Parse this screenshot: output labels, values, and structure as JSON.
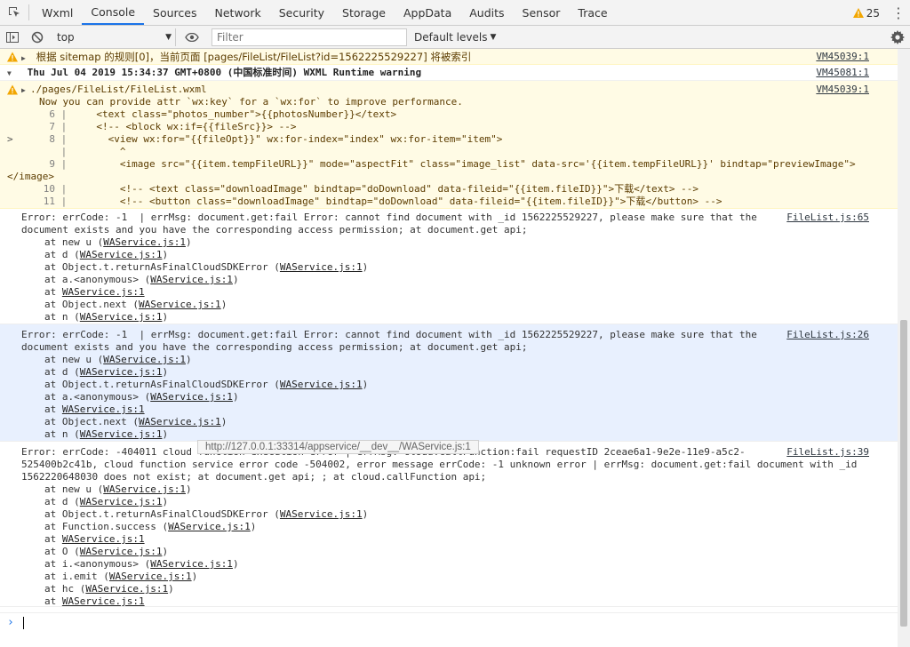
{
  "tabs": [
    "Wxml",
    "Console",
    "Sources",
    "Network",
    "Security",
    "Storage",
    "AppData",
    "Audits",
    "Sensor",
    "Trace"
  ],
  "active_tab": "Console",
  "warning_count": "25",
  "toolbar": {
    "context": "top",
    "filter_placeholder": "Filter",
    "levels": "Default levels"
  },
  "messages": {
    "w1": {
      "text": "根据 sitemap 的规则[0]，当前页面 [pages/FileList/FileList?id=1562225529227] 将被索引",
      "source": "VM45039:1"
    },
    "group": {
      "text": "Thu Jul 04 2019 15:34:37 GMT+0800 (中国标准时间) WXML Runtime warning",
      "source": "VM45081:1"
    },
    "w2": {
      "path": "./pages/FileList/FileList.wxml",
      "source": "VM45039:1",
      "hint": "Now you can provide attr `wx:key` for a `wx:for` to improve performance.",
      "code": [
        {
          "ln": "6",
          "gut": "",
          "text": "     <text class=\"photos_number\">{{photosNumber}}</text>"
        },
        {
          "ln": "7",
          "gut": "",
          "text": "     <!-- <block wx:if={{fileSrc}}> -->"
        },
        {
          "ln": "8",
          "gut": ">",
          "text": "       <view wx:for=\"{{fileOpt}}\" wx:for-index=\"index\" wx:for-item=\"item\">"
        },
        {
          "ln": "",
          "gut": "",
          "text": "         ^"
        },
        {
          "ln": "9",
          "gut": "",
          "text": "         <image src=\"{{item.tempFileURL}}\" mode=\"aspectFit\" class=\"image_list\" data-src='{{item.tempFileURL}}' bindtap=\"previewImage\">"
        },
        {
          "ln": "",
          "gut": "",
          "text": "</image>"
        },
        {
          "ln": "10",
          "gut": "",
          "text": "         <!-- <text class=\"downloadImage\" bindtap=\"doDownload\" data-fileid=\"{{item.fileID}}\">下载</text> -->"
        },
        {
          "ln": "11",
          "gut": "",
          "text": "         <!-- <button class=\"downloadImage\" bindtap=\"doDownload\" data-fileid=\"{{item.fileID}}\">下载</button> -->"
        }
      ]
    },
    "e1": {
      "line1": "Error: errCode: -1  | errMsg: document.get:fail Error: cannot find document with _id 1562225529227, please make sure that the",
      "line2": "document exists and you have the corresponding access permission; at document.get api;",
      "source": "FileList.js:65"
    },
    "e2": {
      "line1": "Error: errCode: -1  | errMsg: document.get:fail Error: cannot find document with _id 1562225529227, please make sure that the",
      "line2": "document exists and you have the corresponding access permission; at document.get api;",
      "source": "FileList.js:26"
    },
    "e3": {
      "line1": "Error: errCode: -404011 cloud function execution error | errMsg: cloud.callFunction:fail requestID 2ceae6a1-9e2e-11e9-a5c2-",
      "line2": "525400b2c41b, cloud function service error code -504002, error message errCode: -1 unknown error | errMsg: document.get:fail document with _id",
      "line3": "1562220648030 does not exist; at document.get api; ; at cloud.callFunction api;",
      "source": "FileList.js:39"
    }
  },
  "stacks": {
    "e1": [
      {
        "pre": "at new u (",
        "link": "WAService.js:1",
        "post": ")"
      },
      {
        "pre": "at d (",
        "link": "WAService.js:1",
        "post": ")"
      },
      {
        "pre": "at Object.t.returnAsFinalCloudSDKError (",
        "link": "WAService.js:1",
        "post": ")"
      },
      {
        "pre": "at a.<anonymous> (",
        "link": "WAService.js:1",
        "post": ")"
      },
      {
        "pre": "at ",
        "link": "WAService.js:1",
        "post": ""
      },
      {
        "pre": "at Object.next (",
        "link": "WAService.js:1",
        "post": ")"
      },
      {
        "pre": "at n (",
        "link": "WAService.js:1",
        "post": ")"
      }
    ],
    "e2": [
      {
        "pre": "at new u (",
        "link": "WAService.js:1",
        "post": ")"
      },
      {
        "pre": "at d (",
        "link": "WAService.js:1",
        "post": ")"
      },
      {
        "pre": "at Object.t.returnAsFinalCloudSDKError (",
        "link": "WAService.js:1",
        "post": ")"
      },
      {
        "pre": "at a.<anonymous> (",
        "link": "WAService.js:1",
        "post": ")"
      },
      {
        "pre": "at ",
        "link": "WAService.js:1",
        "post": ""
      },
      {
        "pre": "at Object.next (",
        "link": "WAService.js:1",
        "post": ")"
      },
      {
        "pre": "at n (",
        "link": "WAService.js:1",
        "post": ")"
      }
    ],
    "e3": [
      {
        "pre": "at new u (",
        "link": "WAService.js:1",
        "post": ")"
      },
      {
        "pre": "at d (",
        "link": "WAService.js:1",
        "post": ")"
      },
      {
        "pre": "at Object.t.returnAsFinalCloudSDKError (",
        "link": "WAService.js:1",
        "post": ")"
      },
      {
        "pre": "at Function.success (",
        "link": "WAService.js:1",
        "post": ")"
      },
      {
        "pre": "at ",
        "link": "WAService.js:1",
        "post": ""
      },
      {
        "pre": "at O (",
        "link": "WAService.js:1",
        "post": ")"
      },
      {
        "pre": "at i.<anonymous> (",
        "link": "WAService.js:1",
        "post": ")"
      },
      {
        "pre": "at i.emit (",
        "link": "WAService.js:1",
        "post": ")"
      },
      {
        "pre": "at hc (",
        "link": "WAService.js:1",
        "post": ")"
      },
      {
        "pre": "at ",
        "link": "WAService.js:1",
        "post": ""
      }
    ]
  },
  "tooltip": "http://127.0.0.1:33314/appservice/__dev__/WAService.js:1",
  "colors": {
    "accent": "#1a73e8",
    "warning_icon": "#f2a600",
    "warning_bg": "#fffbe5",
    "highlight_bg": "#e8f0fe"
  }
}
